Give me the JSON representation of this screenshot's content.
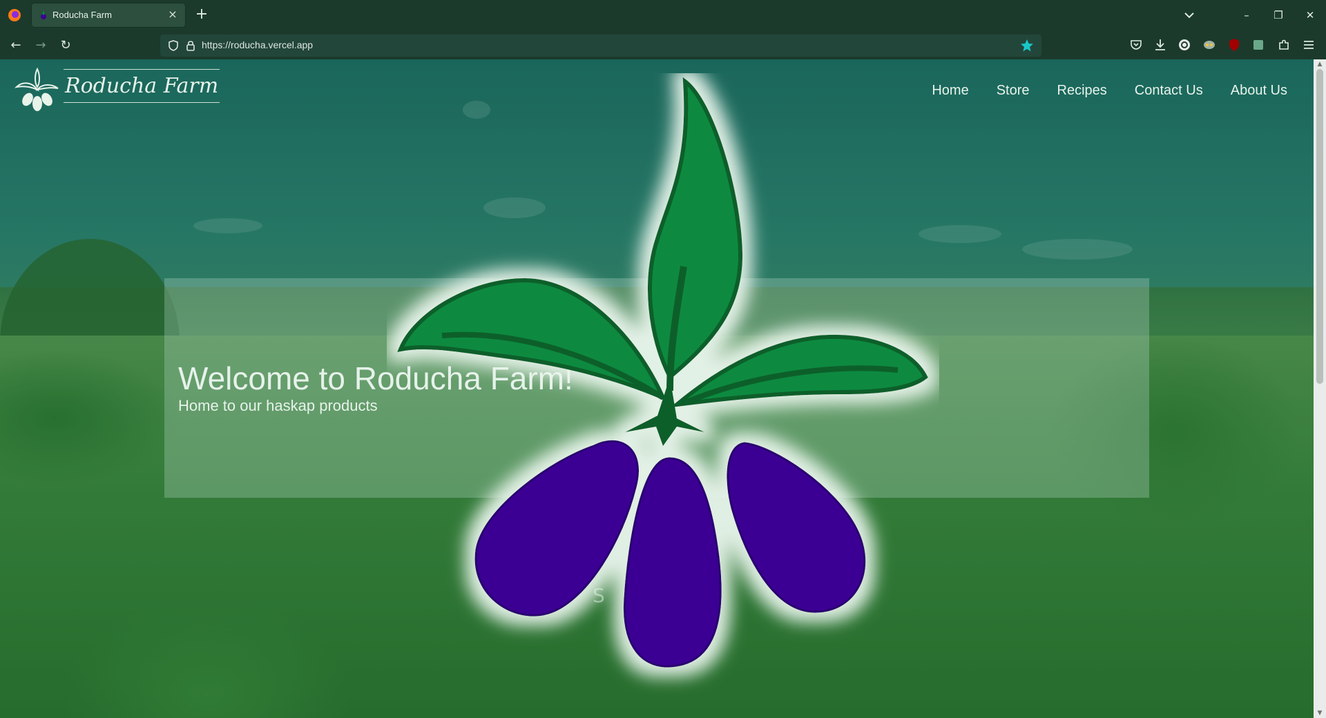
{
  "browser": {
    "tab_title": "Roducha Farm",
    "tab_close": "×",
    "new_tab": "+",
    "url": "https://roducha.vercel.app",
    "window_controls": {
      "minimize": "–",
      "restore": "❐",
      "close": "✕"
    },
    "nav": {
      "back": "←",
      "forward": "→",
      "reload": "↻"
    },
    "accent_color": "#1b3a2c",
    "bookmark_color": "#19c7c7"
  },
  "site": {
    "brand": "Roducha Farm",
    "nav": [
      {
        "label": "Home"
      },
      {
        "label": "Store"
      },
      {
        "label": "Recipes"
      },
      {
        "label": "Contact Us"
      },
      {
        "label": "About Us"
      }
    ],
    "hero": {
      "title": "Welcome to Roducha Farm!",
      "subtitle": "Home to our haskap products"
    },
    "shop_hint": "S",
    "logo_colors": {
      "leaf": "#0a8a41",
      "leaf_dark": "#075e2c",
      "berry": "#3a0093"
    }
  }
}
